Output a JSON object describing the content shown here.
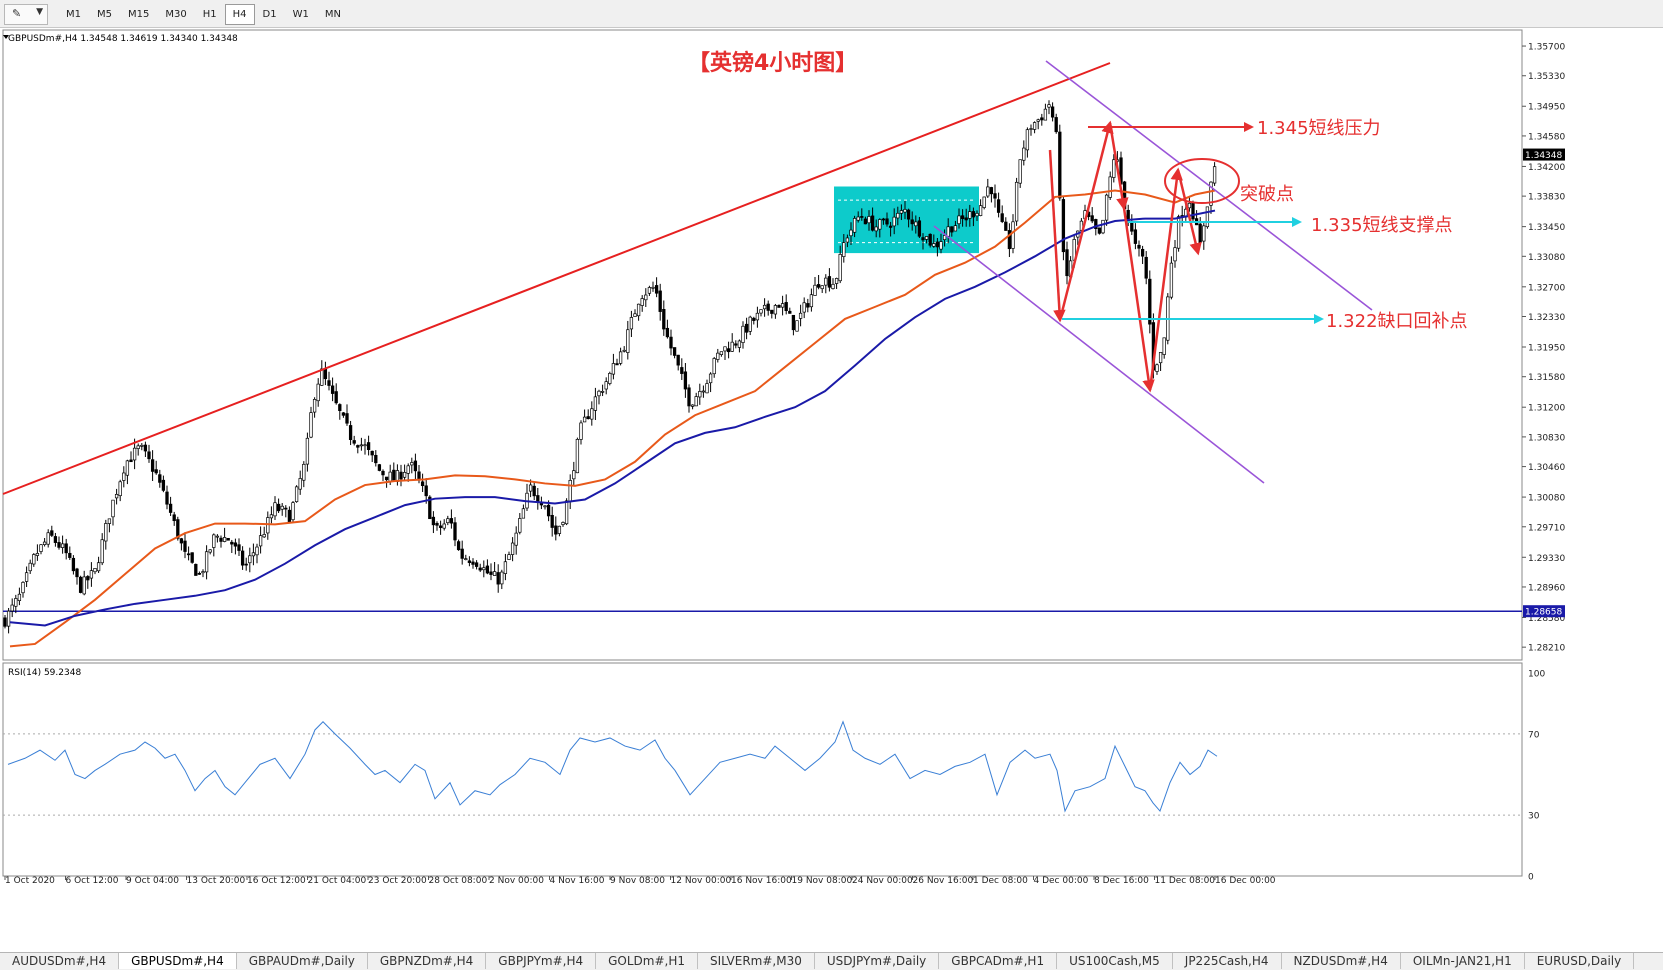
{
  "toolbar": {
    "timeframes": [
      "M1",
      "M5",
      "M15",
      "M30",
      "H1",
      "H4",
      "D1",
      "W1",
      "MN"
    ],
    "active_timeframe": "H4"
  },
  "chart_data": [
    {
      "type": "candlestick",
      "symbol_header": "GBPUSDm#,H4  1.34548 1.34619 1.34340 1.34348",
      "title": "【英镑4小时图】",
      "ylim": [
        1.2805,
        1.359
      ],
      "y_ticks": [
        "1.35700",
        "1.35330",
        "1.34950",
        "1.34580",
        "1.34200",
        "1.33830",
        "1.33450",
        "1.33080",
        "1.32700",
        "1.32330",
        "1.31950",
        "1.31580",
        "1.31200",
        "1.30830",
        "1.30460",
        "1.30080",
        "1.29710",
        "1.29330",
        "1.28960",
        "1.28580",
        "1.28210"
      ],
      "current_price_label": "1.34348",
      "current_price": 1.34348,
      "hline_label": "1.28658",
      "hline_value": 1.28658,
      "x_labels": [
        "1 Oct 2020",
        "6 Oct 12:00",
        "9 Oct 04:00",
        "13 Oct 20:00",
        "16 Oct 12:00",
        "21 Oct 04:00",
        "23 Oct 20:00",
        "28 Oct 08:00",
        "2 Nov 00:00",
        "4 Nov 16:00",
        "9 Nov 08:00",
        "12 Nov 00:00",
        "16 Nov 16:00",
        "19 Nov 08:00",
        "24 Nov 00:00",
        "26 Nov 16:00",
        "1 Dec 08:00",
        "4 Dec 00:00",
        "8 Dec 16:00",
        "11 Dec 08:00",
        "16 Dec 00:00"
      ],
      "close_path": [
        [
          0,
          1.2855
        ],
        [
          15,
          1.2885
        ],
        [
          30,
          1.2935
        ],
        [
          45,
          1.296
        ],
        [
          60,
          1.294
        ],
        [
          75,
          1.2895
        ],
        [
          90,
          1.2915
        ],
        [
          105,
          1.299
        ],
        [
          120,
          1.305
        ],
        [
          135,
          1.307
        ],
        [
          150,
          1.304
        ],
        [
          165,
          1.299
        ],
        [
          180,
          1.2935
        ],
        [
          195,
          1.291
        ],
        [
          210,
          1.296
        ],
        [
          225,
          1.2955
        ],
        [
          240,
          1.292
        ],
        [
          255,
          1.2955
        ],
        [
          270,
          1.2995
        ],
        [
          285,
          1.2985
        ],
        [
          300,
          1.305
        ],
        [
          308,
          1.313
        ],
        [
          316,
          1.3165
        ],
        [
          330,
          1.3125
        ],
        [
          345,
          1.3085
        ],
        [
          360,
          1.307
        ],
        [
          375,
          1.304
        ],
        [
          390,
          1.303
        ],
        [
          405,
          1.305
        ],
        [
          420,
          1.301
        ],
        [
          430,
          1.2965
        ],
        [
          445,
          1.298
        ],
        [
          455,
          1.2935
        ],
        [
          470,
          1.293
        ],
        [
          485,
          1.291
        ],
        [
          495,
          1.2905
        ],
        [
          510,
          1.2955
        ],
        [
          525,
          1.302
        ],
        [
          540,
          1.3
        ],
        [
          550,
          1.296
        ],
        [
          560,
          1.299
        ],
        [
          575,
          1.309
        ],
        [
          590,
          1.313
        ],
        [
          605,
          1.316
        ],
        [
          620,
          1.32
        ],
        [
          635,
          1.326
        ],
        [
          650,
          1.327
        ],
        [
          660,
          1.3215
        ],
        [
          670,
          1.318
        ],
        [
          685,
          1.3125
        ],
        [
          700,
          1.315
        ],
        [
          715,
          1.319
        ],
        [
          730,
          1.32
        ],
        [
          745,
          1.3225
        ],
        [
          760,
          1.324
        ],
        [
          775,
          1.325
        ],
        [
          790,
          1.322
        ],
        [
          800,
          1.3245
        ],
        [
          815,
          1.328
        ],
        [
          830,
          1.3275
        ],
        [
          840,
          1.333
        ],
        [
          855,
          1.336
        ],
        [
          870,
          1.3345
        ],
        [
          885,
          1.335
        ],
        [
          900,
          1.3365
        ],
        [
          915,
          1.334
        ],
        [
          930,
          1.332
        ],
        [
          945,
          1.3345
        ],
        [
          960,
          1.3355
        ],
        [
          975,
          1.337
        ],
        [
          985,
          1.34
        ],
        [
          995,
          1.335
        ],
        [
          1005,
          1.332
        ],
        [
          1015,
          1.343
        ],
        [
          1025,
          1.347
        ],
        [
          1035,
          1.348
        ],
        [
          1045,
          1.35
        ],
        [
          1052,
          1.345
        ],
        [
          1060,
          1.327
        ],
        [
          1070,
          1.333
        ],
        [
          1080,
          1.336
        ],
        [
          1095,
          1.333
        ],
        [
          1110,
          1.344
        ],
        [
          1120,
          1.337
        ],
        [
          1130,
          1.332
        ],
        [
          1140,
          1.33
        ],
        [
          1148,
          1.317
        ],
        [
          1158,
          1.319
        ],
        [
          1166,
          1.33
        ],
        [
          1175,
          1.336
        ],
        [
          1185,
          1.338
        ],
        [
          1195,
          1.332
        ],
        [
          1203,
          1.338
        ],
        [
          1212,
          1.3435
        ]
      ],
      "ma_orange": [
        [
          5,
          1.2822
        ],
        [
          30,
          1.2825
        ],
        [
          60,
          1.2852
        ],
        [
          90,
          1.288
        ],
        [
          120,
          1.2912
        ],
        [
          150,
          1.2944
        ],
        [
          180,
          1.2963
        ],
        [
          210,
          1.2975
        ],
        [
          240,
          1.2975
        ],
        [
          270,
          1.2974
        ],
        [
          300,
          1.2978
        ],
        [
          330,
          1.3005
        ],
        [
          360,
          1.3023
        ],
        [
          390,
          1.3028
        ],
        [
          420,
          1.303
        ],
        [
          450,
          1.3035
        ],
        [
          480,
          1.3034
        ],
        [
          510,
          1.303
        ],
        [
          540,
          1.3025
        ],
        [
          570,
          1.3022
        ],
        [
          600,
          1.303
        ],
        [
          630,
          1.3052
        ],
        [
          660,
          1.3086
        ],
        [
          690,
          1.311
        ],
        [
          720,
          1.3125
        ],
        [
          750,
          1.314
        ],
        [
          780,
          1.317
        ],
        [
          810,
          1.32
        ],
        [
          840,
          1.323
        ],
        [
          870,
          1.3245
        ],
        [
          900,
          1.326
        ],
        [
          930,
          1.3285
        ],
        [
          960,
          1.33
        ],
        [
          990,
          1.332
        ],
        [
          1020,
          1.335
        ],
        [
          1050,
          1.3382
        ],
        [
          1080,
          1.3385
        ],
        [
          1110,
          1.339
        ],
        [
          1140,
          1.3385
        ],
        [
          1170,
          1.3375
        ],
        [
          1190,
          1.3385
        ],
        [
          1210,
          1.339
        ]
      ],
      "ma_blue": [
        [
          5,
          1.2852
        ],
        [
          40,
          1.2848
        ],
        [
          70,
          1.286
        ],
        [
          100,
          1.2868
        ],
        [
          130,
          1.2875
        ],
        [
          160,
          1.288
        ],
        [
          190,
          1.2885
        ],
        [
          220,
          1.2892
        ],
        [
          250,
          1.2905
        ],
        [
          280,
          1.2925
        ],
        [
          310,
          1.2948
        ],
        [
          340,
          1.2968
        ],
        [
          370,
          1.2983
        ],
        [
          400,
          1.2998
        ],
        [
          430,
          1.3006
        ],
        [
          460,
          1.3008
        ],
        [
          490,
          1.3008
        ],
        [
          520,
          1.3003
        ],
        [
          550,
          1.3
        ],
        [
          580,
          1.3005
        ],
        [
          610,
          1.3025
        ],
        [
          640,
          1.305
        ],
        [
          670,
          1.3075
        ],
        [
          700,
          1.3088
        ],
        [
          730,
          1.3095
        ],
        [
          760,
          1.3108
        ],
        [
          790,
          1.312
        ],
        [
          820,
          1.314
        ],
        [
          850,
          1.3172
        ],
        [
          880,
          1.3205
        ],
        [
          910,
          1.3232
        ],
        [
          940,
          1.3255
        ],
        [
          970,
          1.327
        ],
        [
          1000,
          1.3288
        ],
        [
          1030,
          1.3308
        ],
        [
          1060,
          1.333
        ],
        [
          1090,
          1.3345
        ],
        [
          1110,
          1.3352
        ],
        [
          1140,
          1.3355
        ],
        [
          1170,
          1.3355
        ],
        [
          1190,
          1.336
        ],
        [
          1210,
          1.3365
        ]
      ],
      "annotations": [
        {
          "text": "1.345短线压力",
          "value": 1.345
        },
        {
          "text": "突破点"
        },
        {
          "text": "1.335短线支撑点",
          "value": 1.335
        },
        {
          "text": "1.322缺口回补点",
          "value": 1.322
        }
      ],
      "colors": {
        "up": "#000000",
        "down": "#000000",
        "ma_orange": "#e8591a",
        "ma_blue": "#1a1aa8",
        "trend_red": "#e62020",
        "channel": "#9a55d8",
        "box": "#00c8c8",
        "arrow_red": "#e53030",
        "arrow_cyan": "#20d0e0",
        "hline": "#1a1aa8",
        "label_red": "#e53030"
      }
    },
    {
      "type": "line",
      "header": "RSI(14) 59.2348",
      "ylim": [
        0,
        100
      ],
      "y_ticks": [
        "100",
        "70",
        "30",
        "0"
      ],
      "levels": [
        70,
        30
      ],
      "series": [
        {
          "values": [
            [
              3,
              55
            ],
            [
              20,
              58
            ],
            [
              35,
              62
            ],
            [
              50,
              57
            ],
            [
              60,
              62
            ],
            [
              70,
              50
            ],
            [
              80,
              48
            ],
            [
              90,
              52
            ],
            [
              100,
              55
            ],
            [
              115,
              60
            ],
            [
              130,
              62
            ],
            [
              140,
              66
            ],
            [
              150,
              63
            ],
            [
              160,
              58
            ],
            [
              170,
              60
            ],
            [
              180,
              52
            ],
            [
              190,
              42
            ],
            [
              200,
              48
            ],
            [
              210,
              52
            ],
            [
              220,
              44
            ],
            [
              230,
              40
            ],
            [
              240,
              46
            ],
            [
              255,
              55
            ],
            [
              270,
              58
            ],
            [
              285,
              48
            ],
            [
              300,
              60
            ],
            [
              310,
              72
            ],
            [
              318,
              76
            ],
            [
              330,
              70
            ],
            [
              345,
              63
            ],
            [
              360,
              55
            ],
            [
              370,
              50
            ],
            [
              380,
              52
            ],
            [
              395,
              46
            ],
            [
              410,
              55
            ],
            [
              420,
              52
            ],
            [
              430,
              38
            ],
            [
              445,
              46
            ],
            [
              455,
              35
            ],
            [
              470,
              42
            ],
            [
              485,
              40
            ],
            [
              495,
              45
            ],
            [
              510,
              50
            ],
            [
              525,
              58
            ],
            [
              540,
              56
            ],
            [
              555,
              50
            ],
            [
              565,
              62
            ],
            [
              575,
              68
            ],
            [
              590,
              66
            ],
            [
              605,
              68
            ],
            [
              620,
              64
            ],
            [
              635,
              62
            ],
            [
              650,
              67
            ],
            [
              660,
              58
            ],
            [
              670,
              52
            ],
            [
              685,
              40
            ],
            [
              700,
              48
            ],
            [
              715,
              56
            ],
            [
              730,
              58
            ],
            [
              745,
              60
            ],
            [
              760,
              58
            ],
            [
              770,
              64
            ],
            [
              785,
              58
            ],
            [
              800,
              52
            ],
            [
              815,
              58
            ],
            [
              830,
              66
            ],
            [
              838,
              76
            ],
            [
              848,
              62
            ],
            [
              860,
              58
            ],
            [
              875,
              55
            ],
            [
              890,
              60
            ],
            [
              905,
              48
            ],
            [
              920,
              52
            ],
            [
              935,
              50
            ],
            [
              950,
              54
            ],
            [
              965,
              56
            ],
            [
              980,
              60
            ],
            [
              992,
              40
            ],
            [
              1005,
              56
            ],
            [
              1020,
              62
            ],
            [
              1030,
              58
            ],
            [
              1045,
              60
            ],
            [
              1052,
              52
            ],
            [
              1060,
              32
            ],
            [
              1070,
              42
            ],
            [
              1085,
              44
            ],
            [
              1100,
              48
            ],
            [
              1110,
              64
            ],
            [
              1120,
              54
            ],
            [
              1130,
              44
            ],
            [
              1140,
              42
            ],
            [
              1148,
              36
            ],
            [
              1155,
              32
            ],
            [
              1165,
              46
            ],
            [
              1175,
              56
            ],
            [
              1185,
              50
            ],
            [
              1195,
              54
            ],
            [
              1203,
              62
            ],
            [
              1212,
              59
            ]
          ]
        }
      ]
    }
  ],
  "tabs": [
    {
      "label": "AUDUSDm#,H4",
      "active": false
    },
    {
      "label": "GBPUSDm#,H4",
      "active": true
    },
    {
      "label": "GBPAUDm#,Daily",
      "active": false
    },
    {
      "label": "GBPNZDm#,H4",
      "active": false
    },
    {
      "label": "GBPJPYm#,H4",
      "active": false
    },
    {
      "label": "GOLDm#,H1",
      "active": false
    },
    {
      "label": "SILVERm#,M30",
      "active": false
    },
    {
      "label": "USDJPYm#,Daily",
      "active": false
    },
    {
      "label": "GBPCADm#,H1",
      "active": false
    },
    {
      "label": "US100Cash,M5",
      "active": false
    },
    {
      "label": "JP225Cash,H4",
      "active": false
    },
    {
      "label": "NZDUSDm#,H4",
      "active": false
    },
    {
      "label": "OILMn-JAN21,H1",
      "active": false
    },
    {
      "label": "EURUSD,Daily",
      "active": false
    }
  ]
}
